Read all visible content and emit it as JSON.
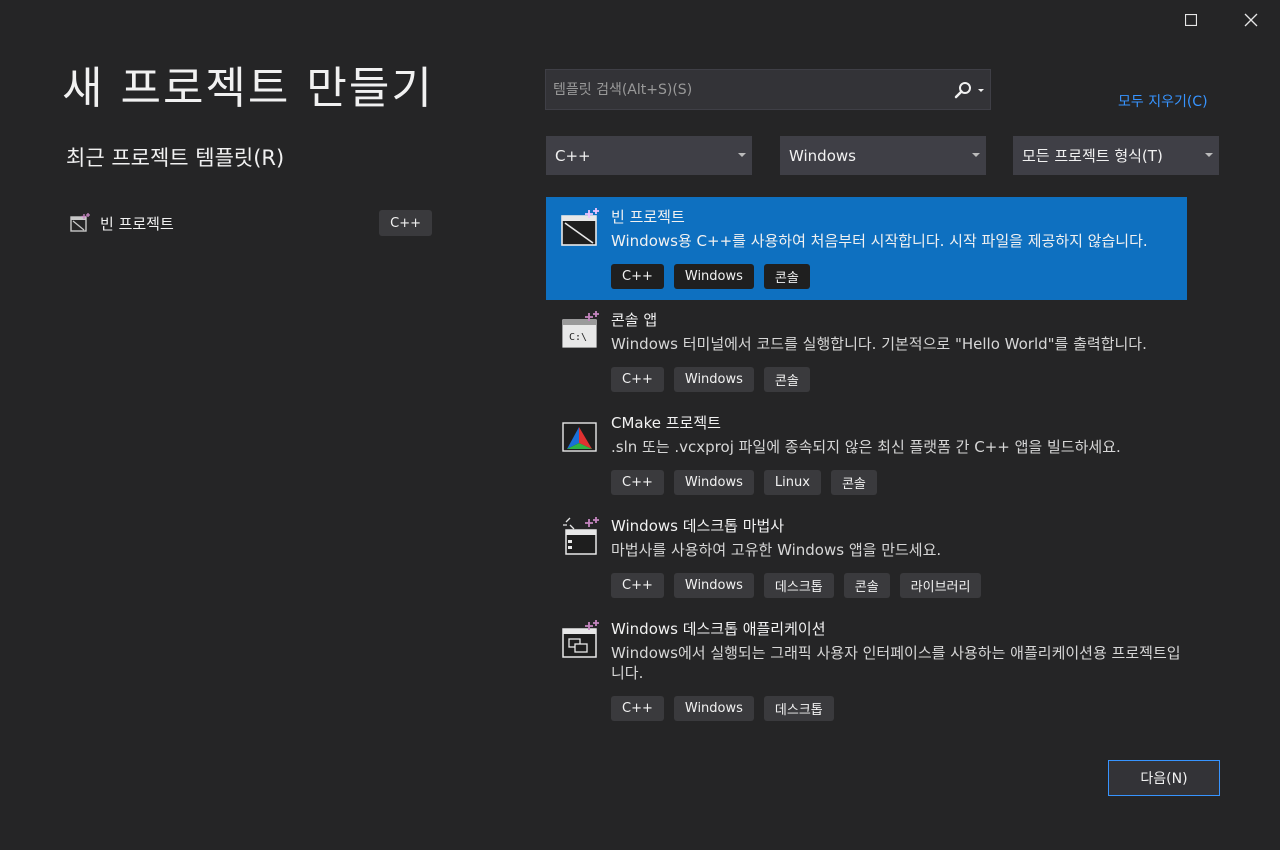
{
  "header": {
    "title": "새 프로젝트 만들기"
  },
  "recent": {
    "title": "최근 프로젝트 템플릿(R)",
    "items": [
      {
        "label": "빈 프로젝트",
        "lang": "C++",
        "icon": "empty-project-icon"
      }
    ]
  },
  "search": {
    "placeholder": "템플릿 검색(Alt+S)(S)",
    "value": ""
  },
  "clear_all": "모두 지우기(C)",
  "filters": {
    "language": "C++",
    "platform": "Windows",
    "project_type": "모든 프로젝트 형식(T)"
  },
  "templates": [
    {
      "name": "빈 프로젝트",
      "desc": "Windows용 C++를 사용하여 처음부터 시작합니다. 시작 파일을 제공하지 않습니다.",
      "tags": [
        "C++",
        "Windows",
        "콘솔"
      ],
      "selected": true,
      "icon": "empty-project-icon"
    },
    {
      "name": "콘솔 앱",
      "desc": "Windows 터미널에서 코드를 실행합니다. 기본적으로 \"Hello World\"를 출력합니다.",
      "tags": [
        "C++",
        "Windows",
        "콘솔"
      ],
      "selected": false,
      "icon": "console-app-icon"
    },
    {
      "name": "CMake 프로젝트",
      "desc": ".sln 또는 .vcxproj 파일에 종속되지 않은 최신 플랫폼 간 C++ 앱을 빌드하세요.",
      "tags": [
        "C++",
        "Windows",
        "Linux",
        "콘솔"
      ],
      "selected": false,
      "icon": "cmake-icon"
    },
    {
      "name": "Windows 데스크톱 마법사",
      "desc": "마법사를 사용하여 고유한 Windows 앱을 만드세요.",
      "tags": [
        "C++",
        "Windows",
        "데스크톱",
        "콘솔",
        "라이브러리"
      ],
      "selected": false,
      "icon": "desktop-wizard-icon"
    },
    {
      "name": "Windows 데스크톱 애플리케이션",
      "desc": "Windows에서 실행되는 그래픽 사용자 인터페이스를 사용하는 애플리케이션용 프로젝트입니다.",
      "tags": [
        "C++",
        "Windows",
        "데스크톱"
      ],
      "selected": false,
      "icon": "desktop-app-icon"
    }
  ],
  "footer": {
    "next_label": "다음(N)"
  },
  "colors": {
    "background": "#252526",
    "accent": "#0e70c0",
    "link": "#3794ff",
    "tag": "#3a3a3d"
  }
}
